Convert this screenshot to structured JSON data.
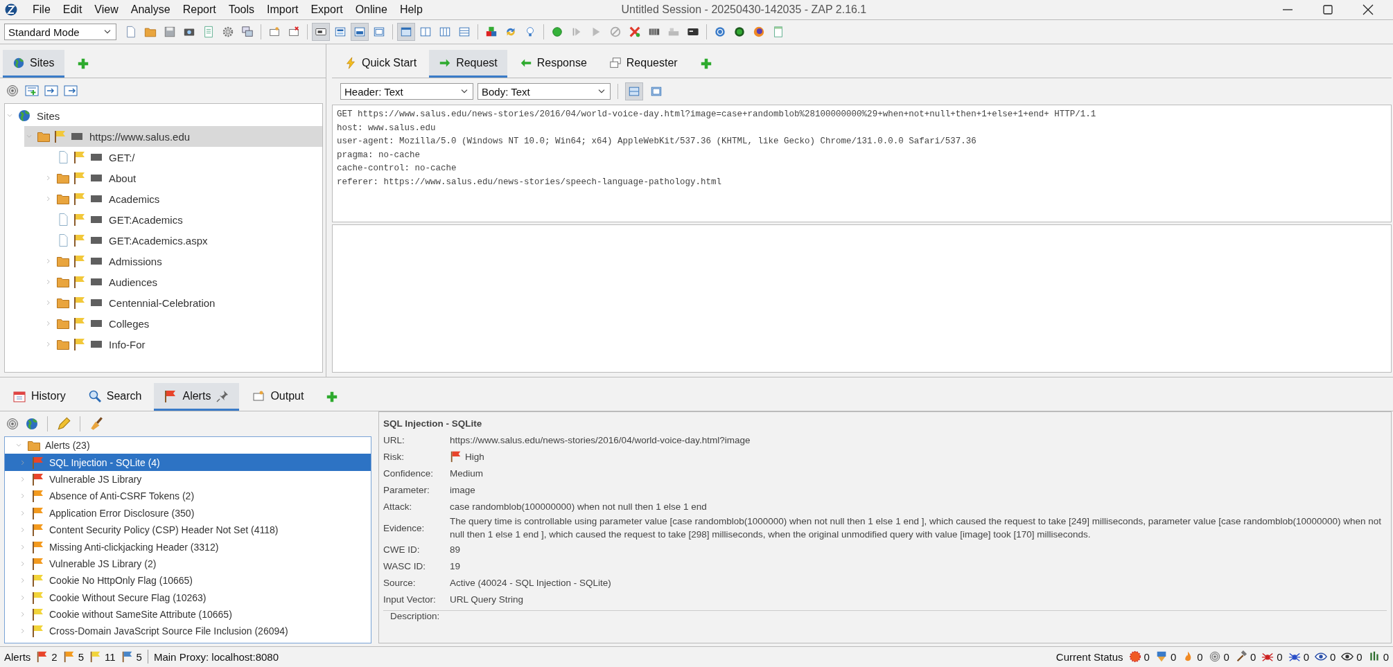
{
  "window": {
    "title": "Untitled Session - 20250430-142035 - ZAP 2.16.1"
  },
  "menu": [
    "File",
    "Edit",
    "View",
    "Analyse",
    "Report",
    "Tools",
    "Import",
    "Export",
    "Online",
    "Help"
  ],
  "toolbar": {
    "mode": "Standard Mode",
    "toggle_groups": [
      [
        {
          "selected": true
        },
        {
          "selected": false
        },
        {
          "selected": true
        },
        {
          "selected": false
        }
      ],
      [
        {
          "selected": true
        },
        {
          "selected": false
        },
        {
          "selected": false
        },
        {
          "selected": false
        }
      ]
    ]
  },
  "sites_panel": {
    "tabs": [
      {
        "label": "Sites",
        "selected": true
      }
    ],
    "tree": {
      "label": "Sites",
      "expanded": true,
      "children": [
        {
          "label": "https://www.salus.edu",
          "kind": "folder",
          "selected": true,
          "expanded": true,
          "children": [
            {
              "label": "GET:/",
              "kind": "page",
              "selected": false
            },
            {
              "label": "About",
              "kind": "folder",
              "selected": false,
              "expanded": false
            },
            {
              "label": "Academics",
              "kind": "folder",
              "selected": false,
              "expanded": false
            },
            {
              "label": "GET:Academics",
              "kind": "page",
              "selected": false
            },
            {
              "label": "GET:Academics.aspx",
              "kind": "page",
              "selected": false
            },
            {
              "label": "Admissions",
              "kind": "folder",
              "selected": false,
              "expanded": false
            },
            {
              "label": "Audiences",
              "kind": "folder",
              "selected": false,
              "expanded": false
            },
            {
              "label": "Centennial-Celebration",
              "kind": "folder",
              "selected": false,
              "expanded": false
            },
            {
              "label": "Colleges",
              "kind": "folder",
              "selected": false,
              "expanded": false
            },
            {
              "label": "Info-For",
              "kind": "folder",
              "selected": false,
              "expanded": false
            }
          ]
        }
      ]
    }
  },
  "work_panel": {
    "tabs": [
      {
        "label": "Quick Start",
        "kind": "bolt",
        "selected": false
      },
      {
        "label": "Request",
        "kind": "right",
        "selected": true
      },
      {
        "label": "Response",
        "kind": "left",
        "selected": false
      },
      {
        "label": "Requester",
        "kind": "windows",
        "selected": false
      }
    ],
    "header_view": "Header: Text",
    "body_view": "Body: Text",
    "layout_buttons": [
      {
        "selected": true
      },
      {
        "selected": false
      }
    ],
    "request_header": [
      "GET https://www.salus.edu/news-stories/2016/04/world-voice-day.html?image=case+randomblob%28100000000%29+when+not+null+then+1+else+1+end+ HTTP/1.1",
      "host: www.salus.edu",
      "user-agent: Mozilla/5.0 (Windows NT 10.0; Win64; x64) AppleWebKit/537.36 (KHTML, like Gecko) Chrome/131.0.0.0 Safari/537.36",
      "pragma: no-cache",
      "cache-control: no-cache",
      "referer: https://www.salus.edu/news-stories/speech-language-pathology.html"
    ]
  },
  "info_panel": {
    "tabs": [
      {
        "label": "History",
        "kind": "calendar",
        "selected": false
      },
      {
        "label": "Search",
        "kind": "magnifier",
        "selected": false
      },
      {
        "label": "Alerts",
        "kind": "flag",
        "selected": true
      },
      {
        "label": "Output",
        "kind": "note",
        "selected": false
      }
    ],
    "alerts_tree": {
      "label": "Alerts (23)",
      "expanded": true,
      "children": [
        {
          "label": "SQL Injection - SQLite (4)",
          "color": "#e8442a",
          "selected": true
        },
        {
          "label": "Vulnerable JS Library",
          "color": "#e8442a",
          "selected": false
        },
        {
          "label": "Absence of Anti-CSRF Tokens (2)",
          "color": "#f39a1e",
          "selected": false
        },
        {
          "label": "Application Error Disclosure (350)",
          "color": "#f39a1e",
          "selected": false
        },
        {
          "label": "Content Security Policy (CSP) Header Not Set (4118)",
          "color": "#f39a1e",
          "selected": false
        },
        {
          "label": "Missing Anti-clickjacking Header (3312)",
          "color": "#f39a1e",
          "selected": false
        },
        {
          "label": "Vulnerable JS Library (2)",
          "color": "#f39a1e",
          "selected": false
        },
        {
          "label": "Cookie No HttpOnly Flag (10665)",
          "color": "#f2d43a",
          "selected": false
        },
        {
          "label": "Cookie Without Secure Flag (10263)",
          "color": "#f2d43a",
          "selected": false
        },
        {
          "label": "Cookie without SameSite Attribute (10665)",
          "color": "#f2d43a",
          "selected": false
        },
        {
          "label": "Cross-Domain JavaScript Source File Inclusion (26094)",
          "color": "#f2d43a",
          "selected": false
        }
      ]
    },
    "alert_detail": {
      "title": "SQL Injection - SQLite",
      "fields": [
        {
          "label": "URL:",
          "value": "https://www.salus.edu/news-stories/2016/04/world-voice-day.html?image"
        },
        {
          "label": "Risk:",
          "value": "High",
          "color": "#e8442a"
        },
        {
          "label": "Confidence:",
          "value": "Medium"
        },
        {
          "label": "Parameter:",
          "value": "image"
        },
        {
          "label": "Attack:",
          "value": "case randomblob(100000000) when not null then 1 else 1 end"
        },
        {
          "label": "Evidence:",
          "value": "The query time is controllable using parameter value [case randomblob(1000000) when not null then 1 else 1 end ], which caused the request to take [249] milliseconds, parameter value [case randomblob(10000000) when not null then 1 else 1 end ], which caused the request to take [298] milliseconds, when the original unmodified query with value [image] took [170] milliseconds."
        },
        {
          "label": "CWE ID:",
          "value": "89"
        },
        {
          "label": "WASC ID:",
          "value": "19"
        },
        {
          "label": "Source:",
          "value": "Active (40024 - SQL Injection - SQLite)"
        },
        {
          "label": "Input Vector:",
          "value": "URL Query String"
        }
      ],
      "section": "Description:"
    }
  },
  "status_bar": {
    "alerts_label": "Alerts",
    "alert_counts": [
      {
        "count": "2",
        "color": "#e8442a"
      },
      {
        "count": "5",
        "color": "#f39a1e"
      },
      {
        "count": "11",
        "color": "#f2d43a"
      },
      {
        "count": "5",
        "color": "#4a86c8"
      }
    ],
    "proxy": "Main Proxy: localhost:8080",
    "status_label": "Current Status",
    "status_counts": [
      {
        "kind": "burst",
        "count": "0"
      },
      {
        "kind": "down",
        "count": "0"
      },
      {
        "kind": "fire",
        "count": "0"
      },
      {
        "kind": "target",
        "count": "0"
      },
      {
        "kind": "hammer",
        "count": "0"
      },
      {
        "kind": "spider",
        "count": "0"
      },
      {
        "kind": "spider2",
        "count": "0"
      },
      {
        "kind": "eye",
        "count": "0"
      },
      {
        "kind": "eye2",
        "count": "0"
      },
      {
        "kind": "bars",
        "count": "0"
      }
    ]
  }
}
